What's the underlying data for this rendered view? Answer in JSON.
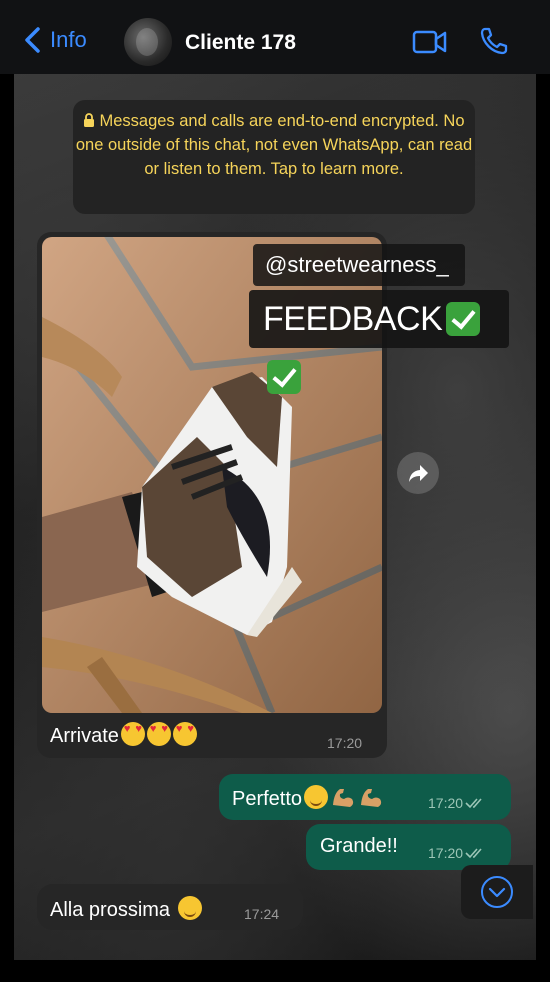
{
  "header": {
    "back_label": "Info",
    "contact_name": "Cliente 178"
  },
  "notice": {
    "text": "Messages and calls are end-to-end encrypted. No one outside of this chat, not even WhatsApp, can read or listen to them. Tap to learn more."
  },
  "messages": [
    {
      "type": "image",
      "direction": "incoming",
      "overlay_tag": "@streetwearness_",
      "overlay_title": "FEEDBACK",
      "caption": "Arrivate",
      "time": "17:20"
    },
    {
      "type": "text",
      "direction": "outgoing",
      "text": "Perfetto",
      "time": "17:20",
      "status": "read"
    },
    {
      "type": "text",
      "direction": "outgoing",
      "text": "Grande!!",
      "time": "17:20",
      "status": "read"
    },
    {
      "type": "text",
      "direction": "incoming",
      "text": "Alla prossima",
      "time": "17:24"
    }
  ],
  "colors": {
    "accent": "#3b8bff",
    "outgoing_bubble": "#0e5c4a",
    "incoming_bubble": "#262626",
    "notice_text": "#f6d45a"
  },
  "icons": [
    "chevron-left-icon",
    "video-call-icon",
    "phone-icon",
    "lock-icon",
    "forward-icon",
    "scroll-down-icon",
    "double-check-icon"
  ]
}
